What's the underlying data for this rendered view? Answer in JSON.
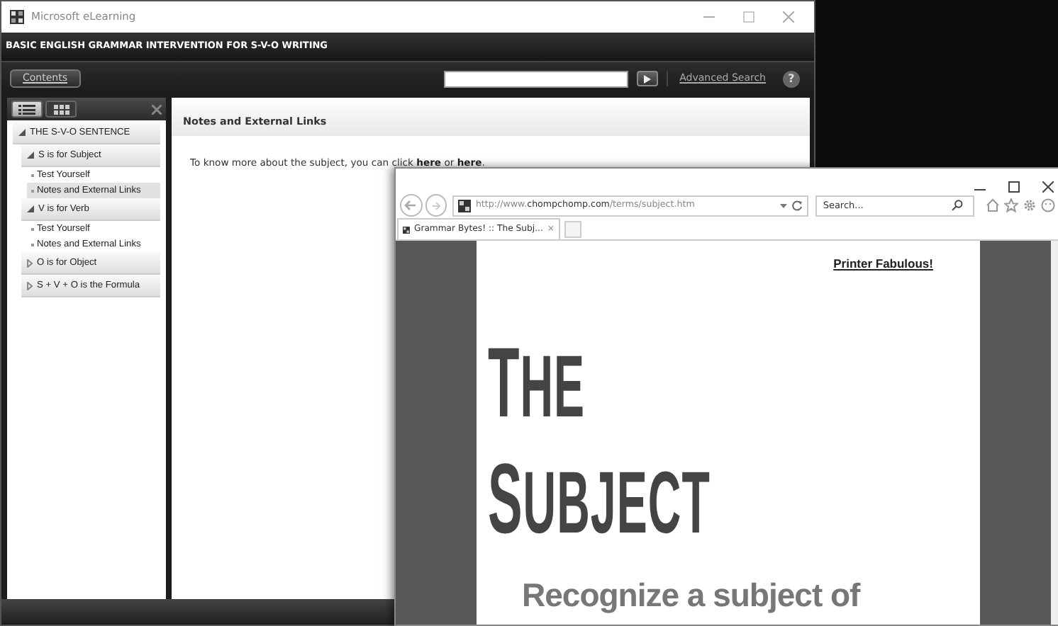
{
  "app_window": {
    "title": "Microsoft eLearning",
    "course_title": "BASIC ENGLISH GRAMMAR INTERVENTION FOR S-V-O WRITING",
    "contents_button": "Contents",
    "advanced_search": "Advanced Search",
    "help_button": "?",
    "sidebar": {
      "views": [
        {
          "kind": "list",
          "selected": true
        },
        {
          "kind": "grid",
          "selected": false
        }
      ],
      "tree": [
        {
          "label": "THE S-V-O SENTENCE",
          "expanded": true,
          "children": [
            {
              "label": "S is for Subject",
              "expanded": true,
              "children": [
                {
                  "label": "Test Yourself",
                  "selected": false
                },
                {
                  "label": "Notes and External Links",
                  "selected": true
                }
              ]
            },
            {
              "label": "V is for Verb",
              "expanded": true,
              "children": [
                {
                  "label": "Test Yourself",
                  "selected": false
                },
                {
                  "label": "Notes and External Links",
                  "selected": false
                }
              ]
            },
            {
              "label": "O is for Object",
              "expanded": false
            },
            {
              "label": "S + V + O is the Formula",
              "expanded": false
            }
          ]
        }
      ]
    },
    "content": {
      "heading": "Notes and External Links",
      "paragraph": [
        {
          "kind": "text",
          "text": "To know more about the subject, you can click "
        },
        {
          "kind": "link",
          "text": "here"
        },
        {
          "kind": "text",
          "text": " or "
        },
        {
          "kind": "link",
          "text": "here"
        },
        {
          "kind": "text",
          "text": "."
        }
      ]
    }
  },
  "browser": {
    "url": "http://www.**chompchomp.com**/terms/subject.htm",
    "search_placeholder": "Search...",
    "tabs": [
      {
        "title": "Grammar Bytes! :: The Subj...",
        "close": "×",
        "selected": true
      }
    ],
    "page": {
      "link": "Printer Fabulous!",
      "title_lines": [
        "THE",
        "SUBJECT"
      ],
      "subtitle": "Recognize a subject of"
    }
  }
}
